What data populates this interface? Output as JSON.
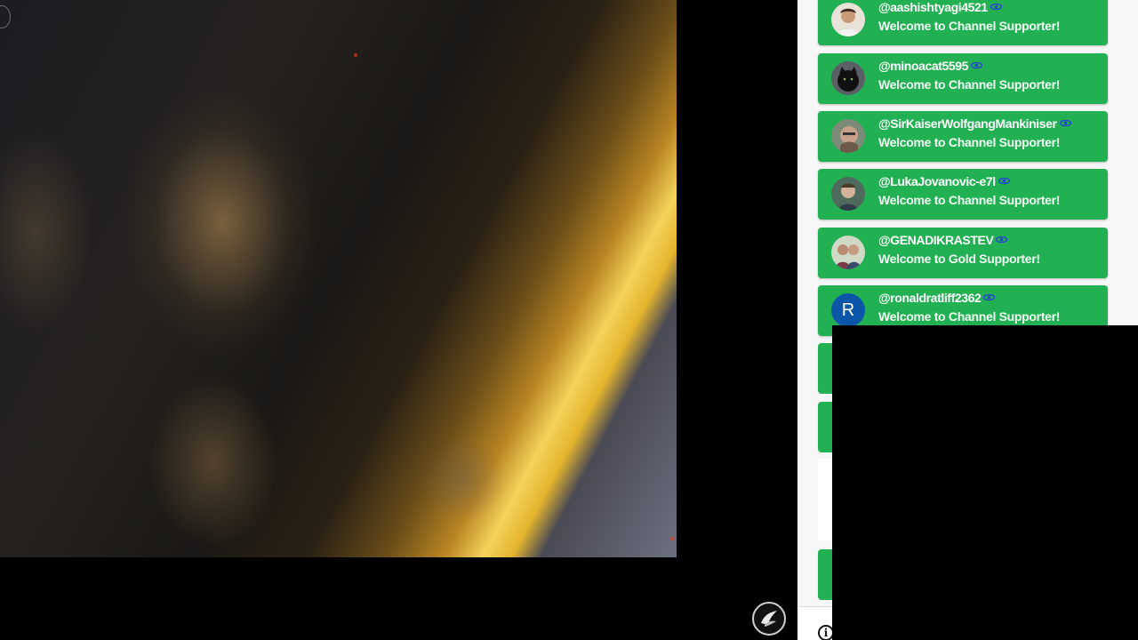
{
  "colors": {
    "card_green": "#21b152",
    "overlay": "#000000",
    "avatar_letter_bg": "#0b56a8"
  },
  "icons": {
    "badge": "member-badge-icon",
    "info": "info-icon",
    "channel_logo": "channel-logo-icon"
  },
  "chat": {
    "messages": [
      {
        "username": "@aashishtyagi4521",
        "message": "Welcome to Channel Supporter!",
        "avatar": "photo"
      },
      {
        "username": "@minoacat5595",
        "message": "Welcome to Channel Supporter!",
        "avatar": "photo"
      },
      {
        "username": "@SirKaiserWolfgangMankiniser",
        "message": "Welcome to Channel Supporter!",
        "avatar": "photo"
      },
      {
        "username": "@LukaJovanovic-e7l",
        "message": "Welcome to Channel Supporter!",
        "avatar": "photo"
      },
      {
        "username": "@GENADIKRASTEV",
        "message": "Welcome to Gold Supporter!",
        "avatar": "photo"
      },
      {
        "username": "@ronaldratliff2362",
        "message": "Welcome to Channel Supporter!",
        "avatar": "R"
      }
    ],
    "info_glyph": "i"
  }
}
